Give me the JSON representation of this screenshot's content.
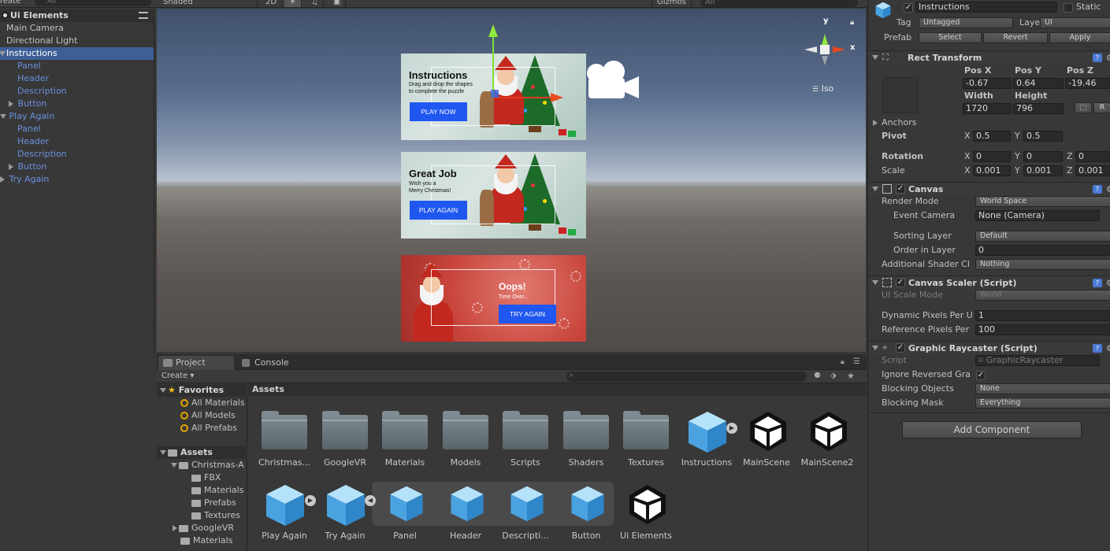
{
  "hierarchy": {
    "create_label": "reate",
    "search_placeholder": "All",
    "scene_name": "Ui Elements",
    "items": [
      {
        "label": "Main Camera"
      },
      {
        "label": "Directional Light"
      },
      {
        "label": "Instructions"
      },
      {
        "label": "Panel"
      },
      {
        "label": "Header"
      },
      {
        "label": "Description"
      },
      {
        "label": "Button"
      },
      {
        "label": "Play Again"
      },
      {
        "label": "Panel"
      },
      {
        "label": "Header"
      },
      {
        "label": "Description"
      },
      {
        "label": "Button"
      },
      {
        "label": "Try Again"
      }
    ]
  },
  "scene_toolbar": {
    "shading_mode": "Shaded",
    "mode_2d": "2D",
    "gizmos_label": "Gizmos",
    "search_placeholder": "All"
  },
  "scene": {
    "iso_label": "Iso",
    "axis_y": "y",
    "axis_x": "x",
    "cards": [
      {
        "title": "Instructions",
        "description": "Drag and drop the shapes\nto complete the puzzle",
        "button": "PLAY NOW"
      },
      {
        "title": "Great Job",
        "description": "Wish you a\nMerry Christmas!",
        "button": "PLAY AGAIN"
      },
      {
        "title": "Oops!",
        "description": "Time Over...",
        "button": "TRY AGAIN"
      }
    ]
  },
  "project": {
    "tabs": [
      "Project",
      "Console"
    ],
    "create_label": "Create",
    "favorites_label": "Favorites",
    "favorites": [
      "All Materials",
      "All Models",
      "All Prefabs"
    ],
    "assets_label": "Assets",
    "asset_tree": [
      "Christmas-A",
      "FBX",
      "Materials",
      "Prefabs",
      "Textures",
      "GoogleVR",
      "Materials"
    ],
    "assets_header": "Assets",
    "assets_row1": [
      {
        "label": "Christmas...",
        "icon": "folder-icon"
      },
      {
        "label": "GoogleVR",
        "icon": "folder-icon"
      },
      {
        "label": "Materials",
        "icon": "folder-icon"
      },
      {
        "label": "Models",
        "icon": "folder-icon"
      },
      {
        "label": "Scripts",
        "icon": "folder-icon"
      },
      {
        "label": "Shaders",
        "icon": "folder-icon"
      },
      {
        "label": "Textures",
        "icon": "folder-icon"
      },
      {
        "label": "Instructions",
        "icon": "prefab-icon"
      },
      {
        "label": "MainScene",
        "icon": "unity-scene-icon"
      },
      {
        "label": "MainScene2",
        "icon": "unity-scene-icon"
      }
    ],
    "assets_row2": [
      {
        "label": "Play Again",
        "icon": "prefab-icon"
      },
      {
        "label": "Try Again",
        "icon": "prefab-icon"
      },
      {
        "label": "Panel",
        "icon": "prefab-icon"
      },
      {
        "label": "Header",
        "icon": "prefab-icon"
      },
      {
        "label": "Descripti...",
        "icon": "prefab-icon"
      },
      {
        "label": "Button",
        "icon": "prefab-icon"
      },
      {
        "label": "Ui Elements",
        "icon": "unity-scene-icon"
      }
    ]
  },
  "inspector": {
    "object_name": "Instructions",
    "static_label": "Static",
    "tag_label": "Tag",
    "tag_value": "Untagged",
    "layer_label": "Layer",
    "layer_value": "UI",
    "prefab_label": "Prefab",
    "prefab_buttons": [
      "Select",
      "Revert",
      "Apply"
    ],
    "rect_transform": {
      "title": "Rect Transform",
      "pos_x_label": "Pos X",
      "pos_y_label": "Pos Y",
      "pos_z_label": "Pos Z",
      "pos_x": "-0.67",
      "pos_y": "0.64",
      "pos_z": "-19.46",
      "width_label": "Width",
      "height_label": "Height",
      "width": "1720",
      "height": "796",
      "r_button": "R",
      "anchors_label": "Anchors",
      "pivot_label": "Pivot",
      "pivot_x": "0.5",
      "pivot_y": "0.5",
      "rotation_label": "Rotation",
      "rot_x": "0",
      "rot_y": "0",
      "rot_z": "0",
      "scale_label": "Scale",
      "scale_x": "0.001",
      "scale_y": "0.001",
      "scale_z": "0.001"
    },
    "canvas": {
      "title": "Canvas",
      "render_mode_label": "Render Mode",
      "render_mode": "World Space",
      "event_camera_label": "Event Camera",
      "event_camera": "None (Camera)",
      "sorting_layer_label": "Sorting Layer",
      "sorting_layer": "Default",
      "order_label": "Order in Layer",
      "order": "0",
      "shader_label": "Additional Shader Cl",
      "shader": "Nothing"
    },
    "canvas_scaler": {
      "title": "Canvas Scaler (Script)",
      "ui_scale_label": "UI Scale Mode",
      "ui_scale": "World",
      "dynamic_label": "Dynamic Pixels Per U",
      "dynamic": "1",
      "reference_label": "Reference Pixels Per",
      "reference": "100"
    },
    "raycaster": {
      "title": "Graphic Raycaster (Script)",
      "script_label": "Script",
      "script": "GraphicRaycaster",
      "ignore_label": "Ignore Reversed Gra",
      "blocking_objects_label": "Blocking Objects",
      "blocking_objects": "None",
      "blocking_mask_label": "Blocking Mask",
      "blocking_mask": "Everything"
    },
    "add_component": "Add Component"
  }
}
